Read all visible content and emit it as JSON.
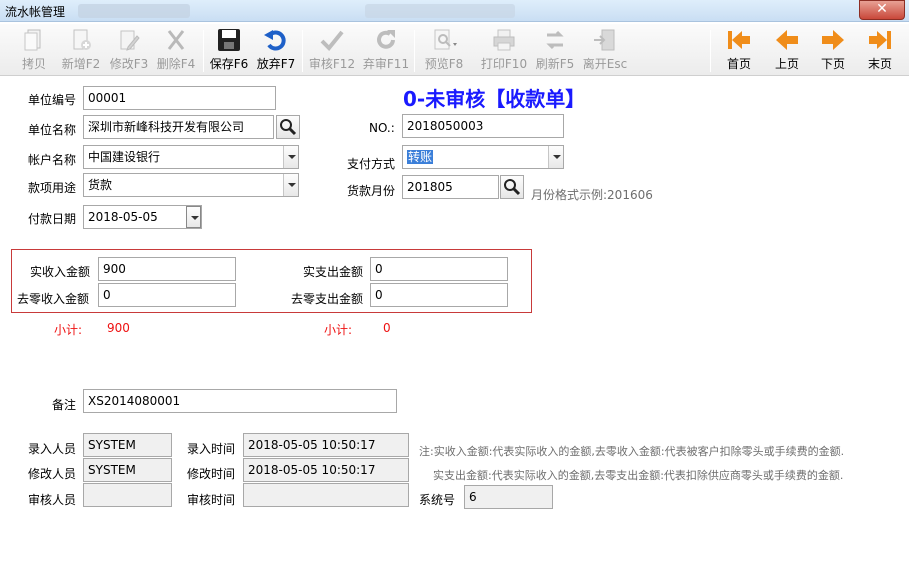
{
  "window": {
    "title": "流水帐管理",
    "close_label": "✕"
  },
  "toolbar": {
    "copy": "拷贝",
    "add": "新增F2",
    "edit": "修改F3",
    "delete": "删除F4",
    "save": "保存F6",
    "discard": "放弃F7",
    "approve": "审核F12",
    "unapprove": "弃审F11",
    "preview": "预览F8",
    "print": "打印F10",
    "refresh": "刷新F5",
    "exit": "离开Esc",
    "first": "首页",
    "prev": "上页",
    "next": "下页",
    "last": "末页"
  },
  "header": {
    "status_title": "0-未审核【收款单】"
  },
  "form": {
    "unit_code_label": "单位编号",
    "unit_code": "00001",
    "unit_name_label": "单位名称",
    "unit_name": "深圳市新峰科技开发有限公司",
    "account_label": "帐户名称",
    "account": "中国建设银行",
    "purpose_label": "款项用途",
    "purpose": "货款",
    "pay_date_label": "付款日期",
    "pay_date": "2018-05-05",
    "no_label": "NO.:",
    "no": "2018050003",
    "pay_method_label": "支付方式",
    "pay_method": "转账",
    "goods_month_label": "货款月份",
    "goods_month": "201805",
    "month_hint": "月份格式示例:201606"
  },
  "amounts": {
    "income_label": "实收入金额",
    "income": "900",
    "round_income_label": "去零收入金额",
    "round_income": "0",
    "expense_label": "实支出金额",
    "expense": "0",
    "round_expense_label": "去零支出金额",
    "round_expense": "0",
    "subtotal_label_1": "小计:",
    "subtotal_1": "900",
    "subtotal_label_2": "小计:",
    "subtotal_2": "0"
  },
  "remark": {
    "label": "备注",
    "value": "XS2014080001"
  },
  "audit": {
    "entry_user_label": "录入人员",
    "entry_user": "SYSTEM",
    "modify_user_label": "修改人员",
    "modify_user": "SYSTEM",
    "review_user_label": "审核人员",
    "review_user": "",
    "entry_time_label": "录入时间",
    "entry_time": "2018-05-05 10:50:17",
    "modify_time_label": "修改时间",
    "modify_time": "2018-05-05 10:50:17",
    "review_time_label": "审核时间",
    "review_time": "",
    "sys_no_label": "系统号",
    "sys_no": "6"
  },
  "notes": {
    "line1": "注:实收入金额:代表实际收入的金额,去零收入金额:代表被客户扣除零头或手续费的金额.",
    "line2": "实支出金额:代表实际收入的金额,去零支出金额:代表扣除供应商零头或手续费的金额."
  }
}
